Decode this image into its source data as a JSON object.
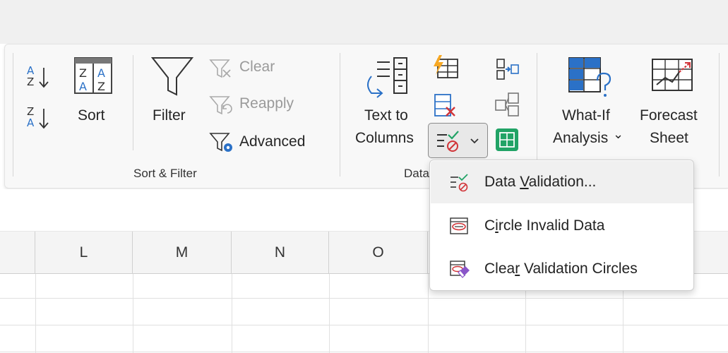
{
  "ribbon": {
    "sort_filter": {
      "sort_label": "Sort",
      "filter_label": "Filter",
      "clear_label": "Clear",
      "reapply_label": "Reapply",
      "advanced_label": "Advanced",
      "group_label": "Sort & Filter"
    },
    "data_tools": {
      "text_to_columns_line1": "Text to",
      "text_to_columns_line2": "Columns",
      "group_label_partial": "Data"
    },
    "forecast": {
      "whatif_line1": "What-If",
      "whatif_line2": "Analysis",
      "whatif_chevron": "⌄",
      "forecast_line1": "Forecast",
      "forecast_line2": "Sheet"
    }
  },
  "dropdown": {
    "items": [
      {
        "pre": "Data ",
        "accel": "V",
        "post": "alidation..."
      },
      {
        "pre": "C",
        "accel": "i",
        "post": "rcle Invalid Data"
      },
      {
        "pre": "Clea",
        "accel": "r",
        "post": " Validation Circles"
      }
    ]
  },
  "sheet": {
    "columns": [
      "L",
      "M",
      "N",
      "O"
    ]
  },
  "colors": {
    "accent_blue": "#2b71c7",
    "green": "#21a366",
    "red": "#d13438",
    "orange": "#f7a823",
    "purple": "#8a55c9"
  },
  "icons": {
    "sort_az": "sort-a-to-z-icon",
    "sort_za": "sort-z-to-a-icon",
    "sort": "sort-icon",
    "filter": "filter-funnel-icon",
    "clear": "clear-filter-icon",
    "reapply": "reapply-filter-icon",
    "advanced": "advanced-filter-icon",
    "text_to_columns": "text-to-columns-icon",
    "flash_fill": "flash-fill-icon",
    "remove_duplicates": "remove-duplicates-icon",
    "data_validation": "data-validation-icon",
    "consolidate": "consolidate-icon",
    "relationships": "relationships-icon",
    "data_model": "data-model-icon",
    "whatif": "what-if-icon",
    "forecast": "forecast-sheet-icon"
  }
}
